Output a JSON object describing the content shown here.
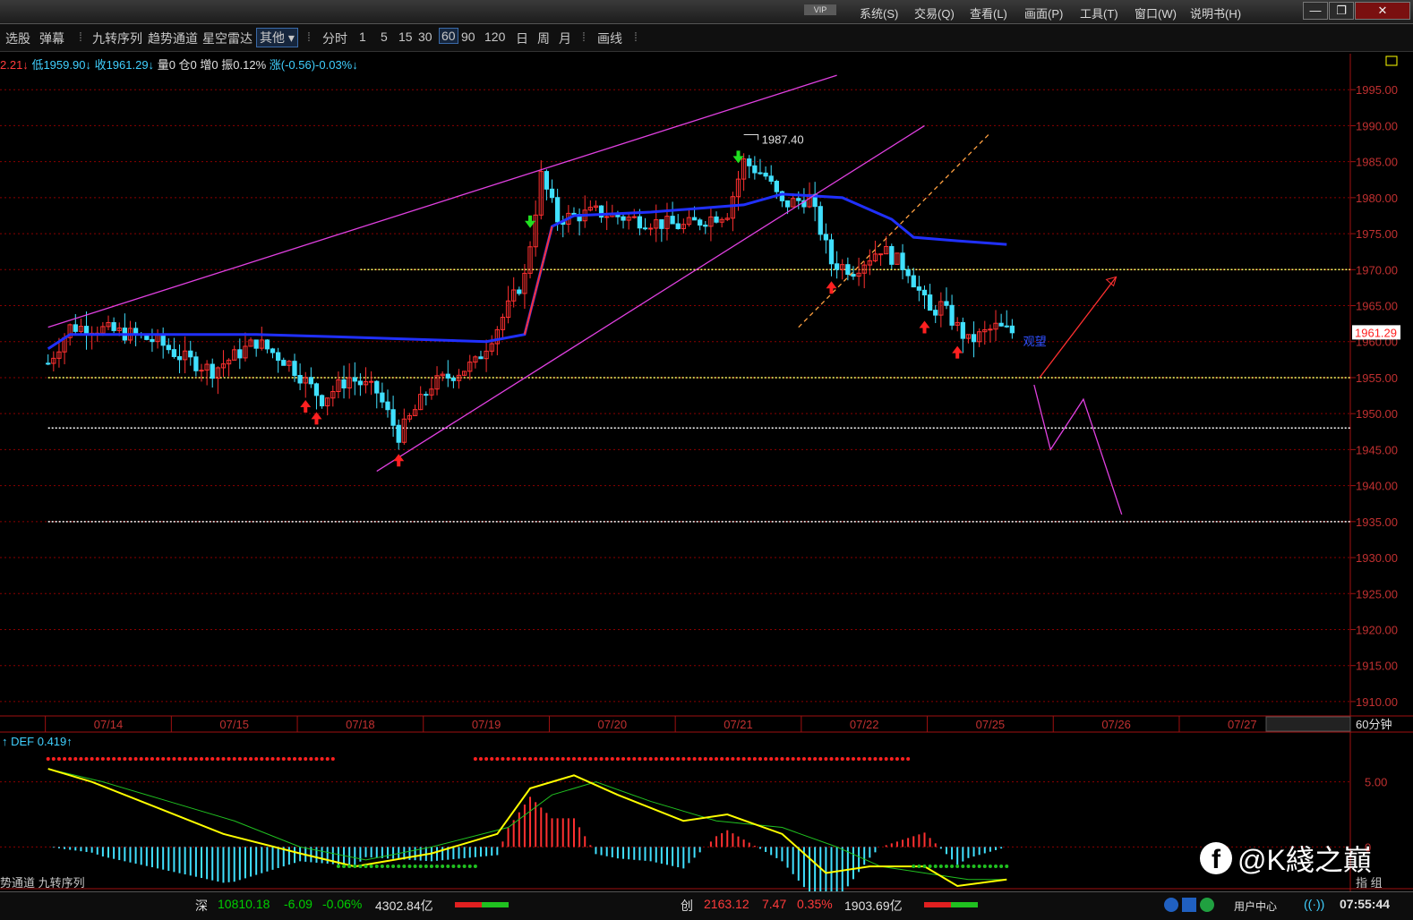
{
  "titlebar": {
    "vip": "VIP",
    "menus": [
      "系统(S)",
      "交易(Q)",
      "查看(L)",
      "画面(P)",
      "工具(T)",
      "窗口(W)",
      "说明书(H)"
    ],
    "win_buttons": [
      "—",
      "❐",
      "✕"
    ]
  },
  "toolbar": {
    "left": [
      "选股",
      "弹幕"
    ],
    "indicators": [
      "九转序列",
      "趋势通道",
      "星空雷达"
    ],
    "other_dropdown": "其他",
    "period_label": "分时",
    "periods": [
      "1",
      "5",
      "15",
      "30",
      "60",
      "90",
      "120",
      "日",
      "周",
      "月"
    ],
    "selected_period": "60",
    "draw": "画线"
  },
  "infobar": {
    "prefix": "2.21↓",
    "low": "低1959.90↓",
    "close": "收1961.29↓",
    "vol": "量0",
    "pos": "仓0",
    "inc": "增0",
    "amp": "振0.12%",
    "chg": "涨(-0.56)-0.03%↓"
  },
  "chart_data": {
    "type": "candlestick",
    "period": "60分钟",
    "y_ticks": [
      1995,
      1990,
      1985,
      1980,
      1975,
      1970,
      1965,
      1960,
      1955,
      1950,
      1945,
      1940,
      1935,
      1930,
      1925,
      1920,
      1915,
      1910
    ],
    "y_tick_labels": [
      "1995.00",
      "1990.00",
      "1985.00",
      "1980.00",
      "1975.00",
      "1970.00",
      "1965.00",
      "1960.00",
      "1955.00",
      "1950.00",
      "1945.00",
      "1940.00",
      "1935.00",
      "1930.00",
      "1925.00",
      "1920.00",
      "1915.00",
      "1910.00"
    ],
    "ylim": [
      1908,
      2000
    ],
    "x_dates": [
      "07/14",
      "07/15",
      "07/18",
      "07/19",
      "07/20",
      "07/21",
      "07/22",
      "07/25",
      "07/26",
      "07/27"
    ],
    "bars_per_day": 23,
    "last_price": "1961.29",
    "high_label": "1987.40",
    "anchors": [
      [
        0,
        1957
      ],
      [
        4,
        1962
      ],
      [
        8,
        1962
      ],
      [
        15,
        1961
      ],
      [
        20,
        1960
      ],
      [
        24,
        1958
      ],
      [
        30,
        1956
      ],
      [
        38,
        1960
      ],
      [
        44,
        1957
      ],
      [
        50,
        1952
      ],
      [
        55,
        1955
      ],
      [
        60,
        1953
      ],
      [
        64,
        1947
      ],
      [
        70,
        1954
      ],
      [
        78,
        1957
      ],
      [
        82,
        1962
      ],
      [
        87,
        1969
      ],
      [
        90,
        1983
      ],
      [
        93,
        1977
      ],
      [
        100,
        1978
      ],
      [
        107,
        1977
      ],
      [
        116,
        1976
      ],
      [
        124,
        1978
      ],
      [
        127,
        1985
      ],
      [
        131,
        1983
      ],
      [
        134,
        1979
      ],
      [
        139,
        1980
      ],
      [
        143,
        1971
      ],
      [
        147,
        1970
      ],
      [
        152,
        1973
      ],
      [
        157,
        1970
      ],
      [
        161,
        1964
      ],
      [
        163,
        1965
      ],
      [
        168,
        1960
      ],
      [
        173,
        1962
      ],
      [
        176,
        1961.3
      ]
    ],
    "ma_line": [
      [
        0,
        1959
      ],
      [
        4,
        1961
      ],
      [
        20,
        1961
      ],
      [
        38,
        1961
      ],
      [
        60,
        1960.5
      ],
      [
        80,
        1960
      ],
      [
        87,
        1961
      ],
      [
        92,
        1976
      ],
      [
        96,
        1977.5
      ],
      [
        110,
        1978
      ],
      [
        127,
        1979
      ],
      [
        134,
        1980.5
      ],
      [
        145,
        1980
      ],
      [
        154,
        1977
      ],
      [
        158,
        1974.5
      ],
      [
        166,
        1974
      ],
      [
        175,
        1973.5
      ]
    ],
    "horizontal_levels": [
      {
        "value": 1970,
        "color": "#ffff66",
        "from_bar": 57
      },
      {
        "value": 1955,
        "color": "#ffff66",
        "from_bar": 0
      },
      {
        "value": 1948,
        "color": "#ffffff",
        "from_bar": 0
      },
      {
        "value": 1935,
        "color": "#ffffff",
        "from_bar": 0
      }
    ],
    "trend_lines": [
      {
        "color": "#e040e0",
        "points": [
          [
            0,
            1962
          ],
          [
            144,
            1997
          ]
        ]
      },
      {
        "color": "#e040e0",
        "points": [
          [
            60,
            1942
          ],
          [
            160,
            1990
          ]
        ]
      },
      {
        "color": "#ffa040",
        "dashed": true,
        "points": [
          [
            137,
            1962
          ],
          [
            172,
            1989
          ]
        ]
      },
      {
        "color": "#e040e0",
        "points": [
          [
            180,
            1954
          ],
          [
            183,
            1945
          ],
          [
            189,
            1952
          ],
          [
            196,
            1936
          ]
        ]
      },
      {
        "color": "#ff3030",
        "arrow": true,
        "points": [
          [
            181,
            1955
          ],
          [
            195,
            1969
          ]
        ]
      }
    ],
    "buy_arrows": [
      47,
      49,
      64,
      143,
      160,
      166
    ],
    "sell_arrows": [
      88,
      126
    ],
    "annotation_text": "观望",
    "indicator": {
      "name": "DEF",
      "value": "0.419↑",
      "y_ticks": [
        "5.00",
        "0"
      ],
      "ylim": [
        -3,
        8
      ],
      "fast": [
        [
          0,
          6
        ],
        [
          8,
          5
        ],
        [
          20,
          3
        ],
        [
          32,
          1
        ],
        [
          46,
          -0.5
        ],
        [
          56,
          -1.5
        ],
        [
          70,
          -0.5
        ],
        [
          82,
          1
        ],
        [
          88,
          4.5
        ],
        [
          96,
          5.5
        ],
        [
          104,
          4
        ],
        [
          116,
          2
        ],
        [
          124,
          2.5
        ],
        [
          134,
          1
        ],
        [
          142,
          -2
        ],
        [
          150,
          -1.5
        ],
        [
          160,
          -1.5
        ],
        [
          166,
          -3
        ],
        [
          175,
          -2.5
        ]
      ],
      "slow": [
        [
          0,
          6
        ],
        [
          10,
          5
        ],
        [
          22,
          3.5
        ],
        [
          34,
          2
        ],
        [
          46,
          0
        ],
        [
          58,
          -1
        ],
        [
          70,
          0
        ],
        [
          84,
          1.5
        ],
        [
          92,
          4
        ],
        [
          100,
          5
        ],
        [
          110,
          3.5
        ],
        [
          122,
          2
        ],
        [
          134,
          1.5
        ],
        [
          144,
          0
        ],
        [
          152,
          -1.5
        ],
        [
          160,
          -2
        ],
        [
          168,
          -2.5
        ],
        [
          175,
          -2.5
        ]
      ],
      "red_dot_ranges": [
        [
          0,
          52
        ],
        [
          78,
          157
        ]
      ],
      "green_dot_ranges": [
        [
          53,
          78
        ],
        [
          158,
          175
        ]
      ]
    }
  },
  "axis_corner": "60分钟",
  "indicator_tabs": "势通道  九转序列",
  "right_labels": [
    "指",
    "组"
  ],
  "bottom": {
    "sz_label": "深",
    "sz_value": "10810.18",
    "sz_change": "-6.09",
    "sz_pct": "-0.06%",
    "sz_amount": "4302.84亿",
    "cy_label": "创",
    "cy_value": "2163.12",
    "cy_change": "7.47",
    "cy_pct": "0.35%",
    "cy_amount": "1903.69亿",
    "user_center": "用户中心",
    "time": "07:55:44"
  },
  "watermark": "@K綫之巔",
  "colors": {
    "up": "#ff3030",
    "down": "#40e0ff",
    "ma": "#2030ff",
    "grid": "#8b0000",
    "fast": "#ffff00",
    "slow": "#20c020"
  }
}
